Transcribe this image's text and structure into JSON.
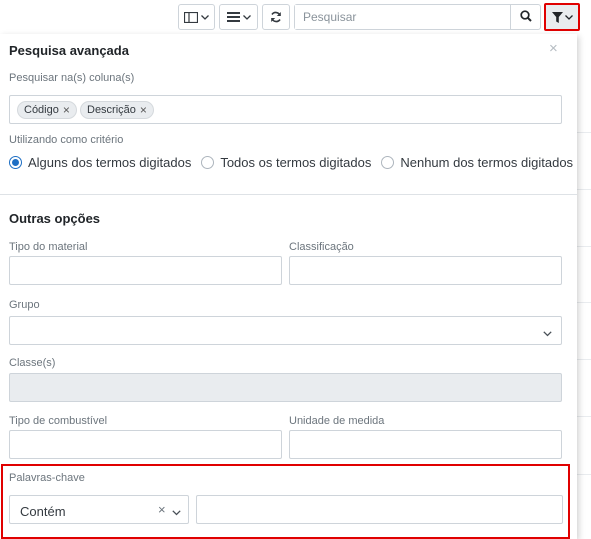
{
  "toolbar": {
    "columns_icon": "columns-icon",
    "menu_icon": "menu-lines-icon",
    "refresh_icon": "refresh-icon",
    "search_placeholder": "Pesquisar",
    "search_icon": "search-icon",
    "filter_icon": "filter-icon"
  },
  "panel": {
    "title": "Pesquisa avançada",
    "close_label": "×",
    "search_columns_label": "Pesquisar na(s) coluna(s)",
    "columns_tags": [
      {
        "label": "Código"
      },
      {
        "label": "Descrição"
      }
    ],
    "criteria_label": "Utilizando como critério",
    "criteria_options": [
      {
        "label": "Alguns dos termos digitados",
        "selected": true
      },
      {
        "label": "Todos os termos digitados",
        "selected": false
      },
      {
        "label": "Nenhum dos termos digitados",
        "selected": false
      }
    ],
    "other_options_title": "Outras opções",
    "fields": {
      "tipo_material": {
        "label": "Tipo do material",
        "value": ""
      },
      "classificacao": {
        "label": "Classificação",
        "value": ""
      },
      "grupo": {
        "label": "Grupo",
        "value": ""
      },
      "classes": {
        "label": "Classe(s)",
        "value": ""
      },
      "tipo_combustivel": {
        "label": "Tipo de combustível",
        "value": ""
      },
      "unidade_medida": {
        "label": "Unidade de medida",
        "value": ""
      },
      "palavras_chave": {
        "label": "Palavras-chave",
        "operator": "Contém",
        "value": ""
      }
    }
  },
  "colors": {
    "highlight": "#e00000",
    "radio_accent": "#1e6fc4",
    "border": "#ced4da"
  }
}
